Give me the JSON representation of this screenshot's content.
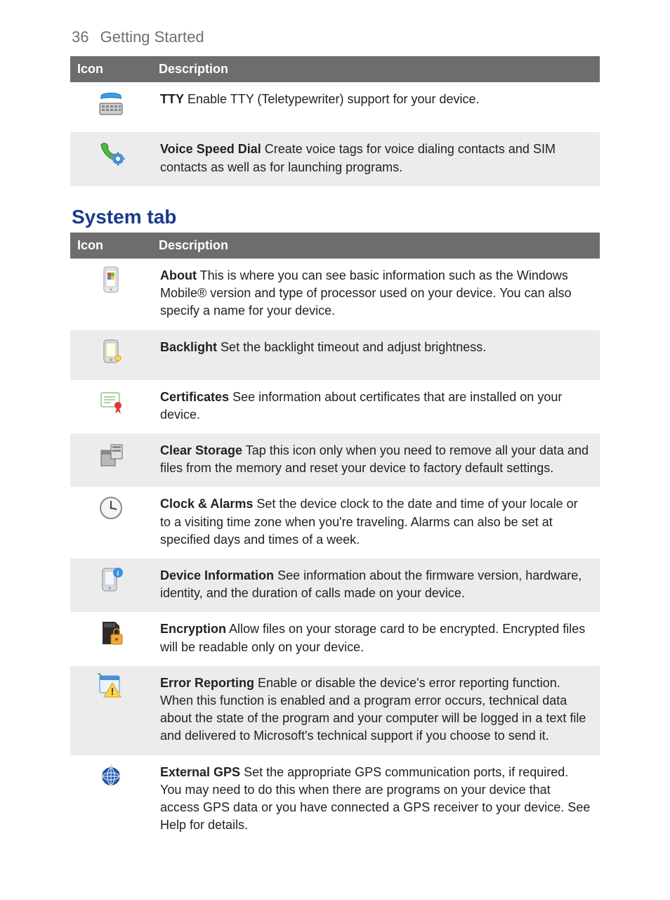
{
  "header": {
    "page_number": "36",
    "section": "Getting Started"
  },
  "table_headers": {
    "icon": "Icon",
    "description": "Description"
  },
  "section1_rows": [
    {
      "icon": "tty-icon",
      "term": "TTY",
      "text": "Enable TTY (Teletypewriter) support for your device."
    },
    {
      "icon": "voice-dial-icon",
      "term": "Voice Speed Dial",
      "text": "Create voice tags for voice dialing contacts and SIM contacts as well as for launching programs."
    }
  ],
  "section2_title": "System tab",
  "section2_rows": [
    {
      "icon": "about-icon",
      "term": "About",
      "text": "This is where you can see basic information such as the Windows Mobile® version and type of processor used on your device. You can also specify a name for your device."
    },
    {
      "icon": "backlight-icon",
      "term": "Backlight",
      "text": "Set the backlight timeout and adjust brightness."
    },
    {
      "icon": "certificates-icon",
      "term": "Certificates",
      "text": "See information about certificates that are installed on your device."
    },
    {
      "icon": "clear-storage-icon",
      "term": "Clear Storage",
      "text": "Tap this icon only when you need to remove all your data and files from the memory and reset your device to factory default settings."
    },
    {
      "icon": "clock-alarms-icon",
      "term": "Clock & Alarms",
      "text": "Set the device clock to the date and time of your locale or to a visiting time zone when you're traveling. Alarms can also be set at specified days and times of a week."
    },
    {
      "icon": "device-info-icon",
      "term": "Device Information",
      "text": "See information about the firmware version, hardware, identity, and the duration of calls made on your device."
    },
    {
      "icon": "encryption-icon",
      "term": "Encryption",
      "text": "Allow files on your storage card to be encrypted. Encrypted files will be readable only on your device."
    },
    {
      "icon": "error-report-icon",
      "term": "Error Reporting",
      "text": "Enable or disable the device's error reporting function. When this function is enabled and a program error occurs, technical data about the state of the program and your computer will be logged in a text file and delivered to Microsoft's technical support if you choose to send it."
    },
    {
      "icon": "external-gps-icon",
      "term": "External GPS",
      "text": "Set the appropriate GPS communication ports, if required. You may need to do this when there are programs on your device that access GPS data or you have connected a GPS receiver to your device. See Help for details."
    }
  ]
}
